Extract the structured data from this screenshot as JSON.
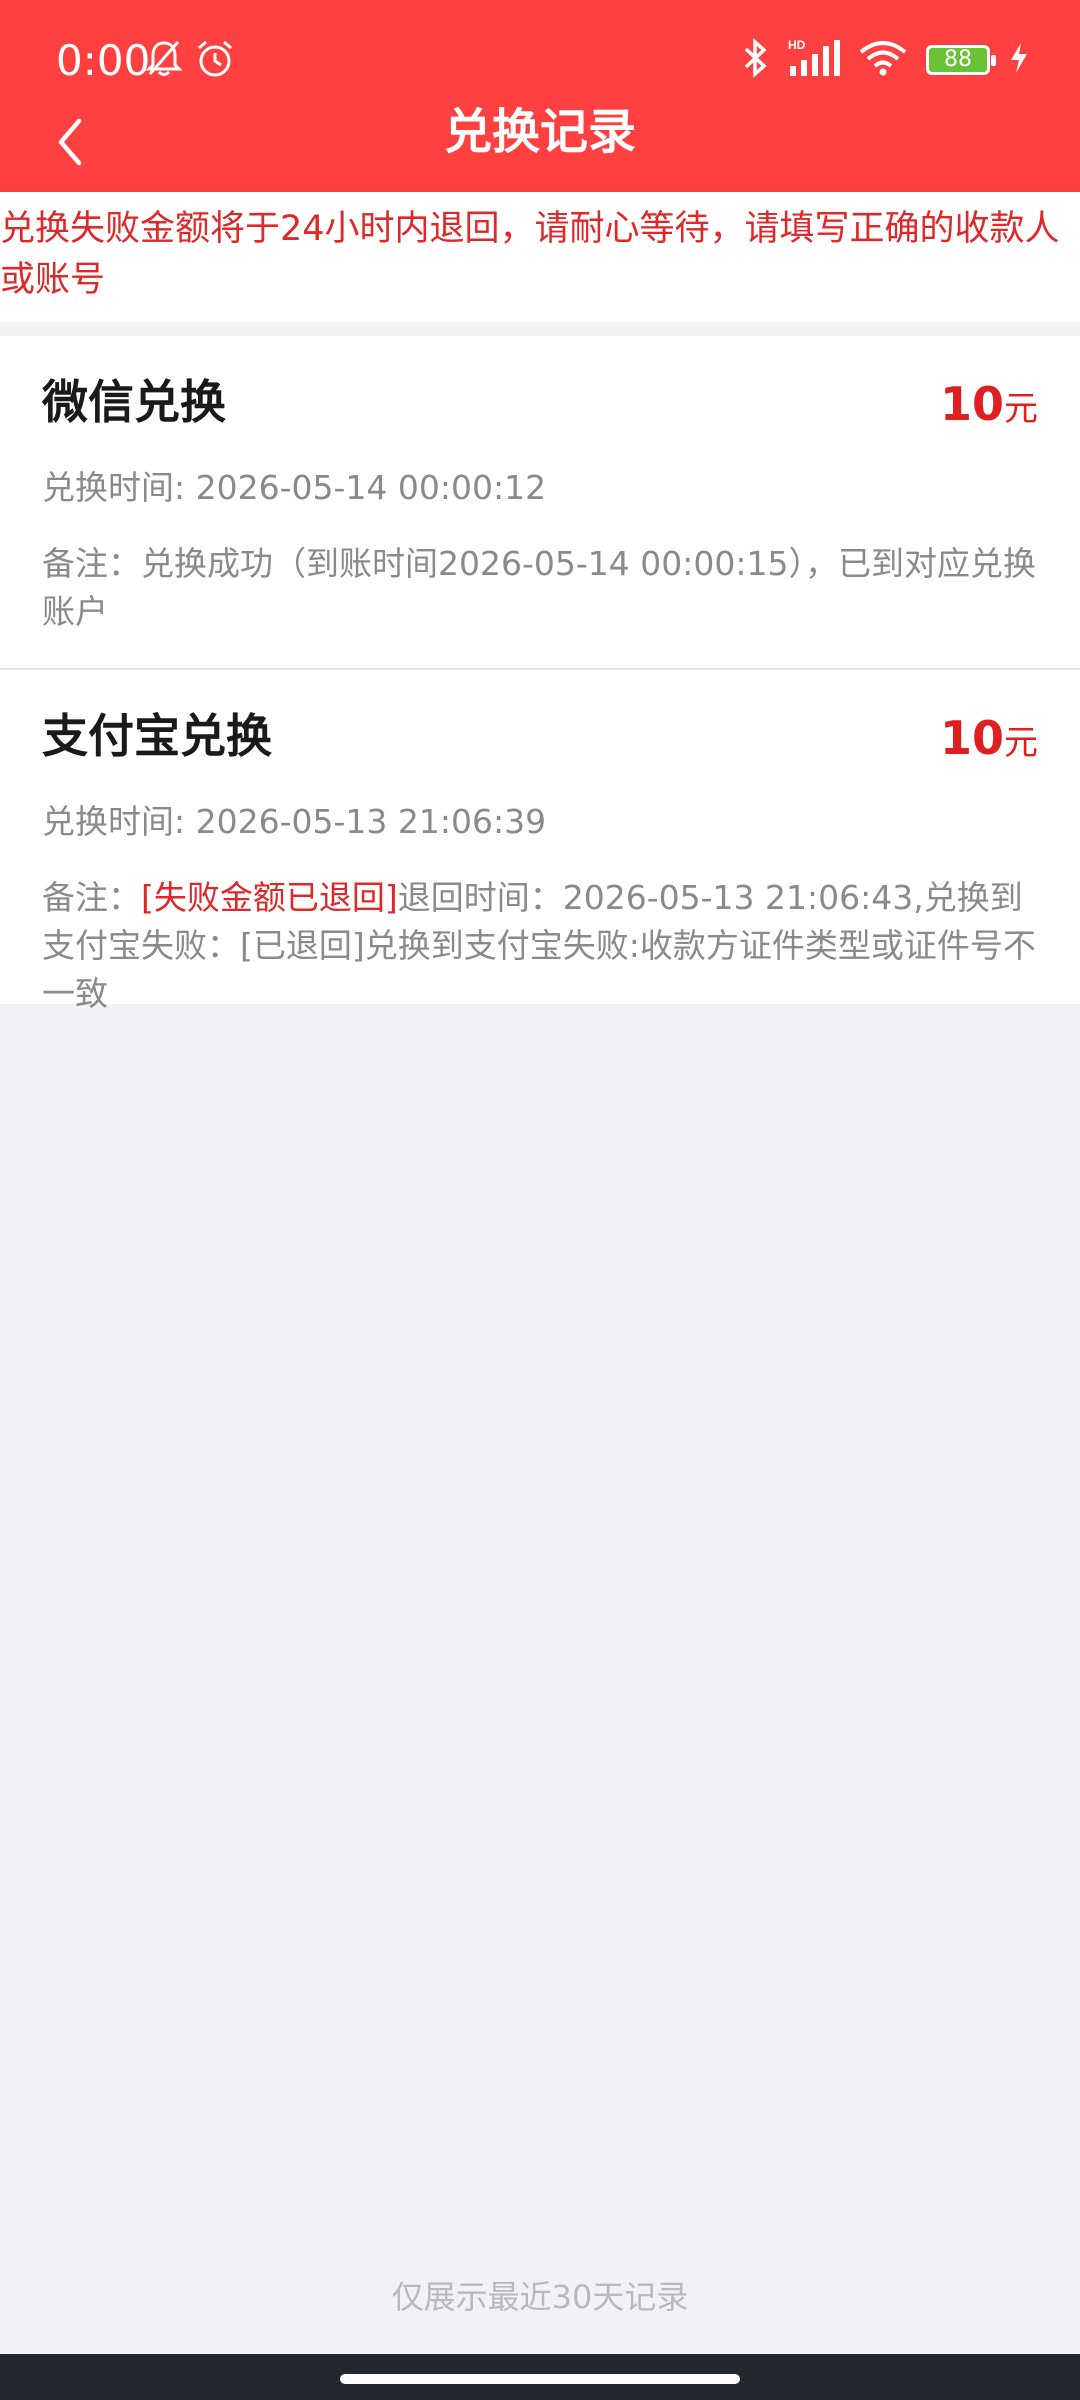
{
  "status_bar": {
    "time": "0:00",
    "battery": "88",
    "icons": [
      "bell-off-icon",
      "alarm-icon",
      "bluetooth-icon",
      "signal-icon",
      "wifi-icon",
      "battery-icon",
      "charging-icon"
    ],
    "hd_label": "HD"
  },
  "nav": {
    "title": "兑换记录",
    "back_icon": "chevron-left-icon"
  },
  "notice": {
    "text": "兑换失败金额将于24小时内退回，请耐心等待，请填写正确的收款人或账号"
  },
  "records": [
    {
      "title": "微信兑换",
      "amount": "10",
      "unit": "元",
      "time": "兑换时间: 2026-05-14 00:00:12",
      "note_prefix": "备注：",
      "note_highlight": "",
      "note_text": "兑换成功（到账时间2026-05-14 00:00:15），已到对应兑换账户"
    },
    {
      "title": "支付宝兑换",
      "amount": "10",
      "unit": "元",
      "time": "兑换时间: 2026-05-13 21:06:39",
      "note_prefix": "备注：",
      "note_highlight": "[失败金额已退回]",
      "note_text": "退回时间：2026-05-13 21:06:43,兑换到支付宝失败：[已退回]兑换到支付宝失败:收款方证件类型或证件号不一致"
    }
  ],
  "footer": {
    "text": "仅展示最近30天记录"
  },
  "colors": {
    "header": "#ff4040",
    "accent_red": "#e02828",
    "background": "#f1f1f6"
  }
}
